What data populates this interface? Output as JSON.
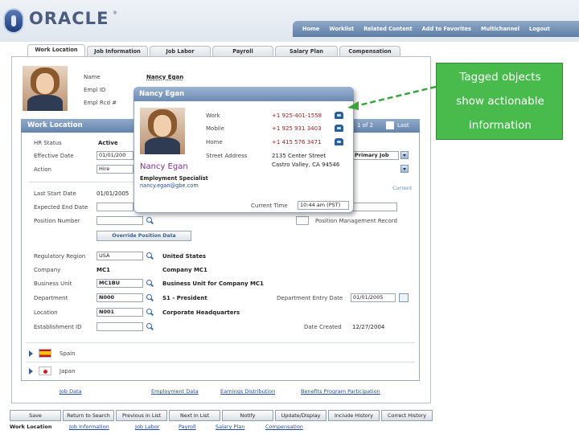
{
  "brand": {
    "name": "ORACLE",
    "tm": "®"
  },
  "topnav": [
    "Home",
    "Worklist",
    "Related Content",
    "Add to Favorites",
    "Multichannel",
    "Logout"
  ],
  "tabs": [
    "Work Location",
    "Job Information",
    "Job Labor",
    "Payroll",
    "Salary Plan",
    "Compensation"
  ],
  "employee": {
    "name_label": "Name",
    "name": "Nancy Egan",
    "emplid_label": "Empl ID",
    "emplrcd_label": "Empl Rcd #"
  },
  "work_location": {
    "title": "Work Location",
    "nav": {
      "of": "1 of 2",
      "last": "Last"
    },
    "hr_status_label": "HR Status",
    "hr_status": "Active",
    "eff_date_label": "Effective Date",
    "eff_date": "01/01/200",
    "action_label": "Action",
    "action": "Hire",
    "job_indicator": "Primary Job",
    "current": "Current",
    "last_start_label": "Last Start Date",
    "last_start": "01/01/2005",
    "expected_end_label": "Expected End Date",
    "position_label": "Position Number",
    "position_mgmt": "Position Management Record",
    "override_btn": "Override Position Data",
    "reg_region_label": "Regulatory Region",
    "reg_region": "USA",
    "reg_region_desc": "United States",
    "company_label": "Company",
    "company": "MC1",
    "company_desc": "Company MC1",
    "bu_label": "Business Unit",
    "bu": "MC1BU",
    "bu_desc": "Business Unit for Company MC1",
    "dept_label": "Department",
    "dept": "N000",
    "dept_desc": "S1 - President",
    "dept_entry_label": "Department Entry Date",
    "dept_entry": "01/01/2005",
    "location_label": "Location",
    "location": "N001",
    "location_desc": "Corporate Headquarters",
    "estab_label": "Establishment ID",
    "date_created_label": "Date Created",
    "date_created": "12/27/2004",
    "countries": [
      "Spain",
      "Japan"
    ]
  },
  "section_links": [
    "Job Data",
    "Employment Data",
    "Earnings Distribution",
    "Benefits Program Participation"
  ],
  "popup": {
    "title": "Nancy Egan",
    "name": "Nancy Egan",
    "job_title": "Employment Specialist",
    "email": "nancy.egan@gbe.com",
    "work_label": "Work",
    "work": "+1 925-401-1558",
    "mobile_label": "Mobile",
    "mobile": "+1 925 931 3403",
    "home_label": "Home",
    "home": "+1 415 576 3471",
    "street_label": "Street Address",
    "street1": "2135 Center Street",
    "street2": "Castro Valley, CA 94546",
    "time_label": "Current Time",
    "time": "10:44 am (PST)"
  },
  "callout": {
    "line1": "Tagged objects",
    "line2": "show actionable",
    "line3": "information"
  },
  "bottom_buttons": [
    "Save",
    "Return to Search",
    "Previous in List",
    "Next in List",
    "Notify",
    "Update/Display",
    "Include History",
    "Correct History"
  ],
  "bottom_links": [
    "Work Location",
    "Job Information",
    "Job Labor",
    "Payroll",
    "Salary Plan",
    "Compensation"
  ],
  "colors": {
    "callout": "#48bb4c",
    "header_bar": "#6f8db3",
    "link": "#1f4aa0"
  }
}
